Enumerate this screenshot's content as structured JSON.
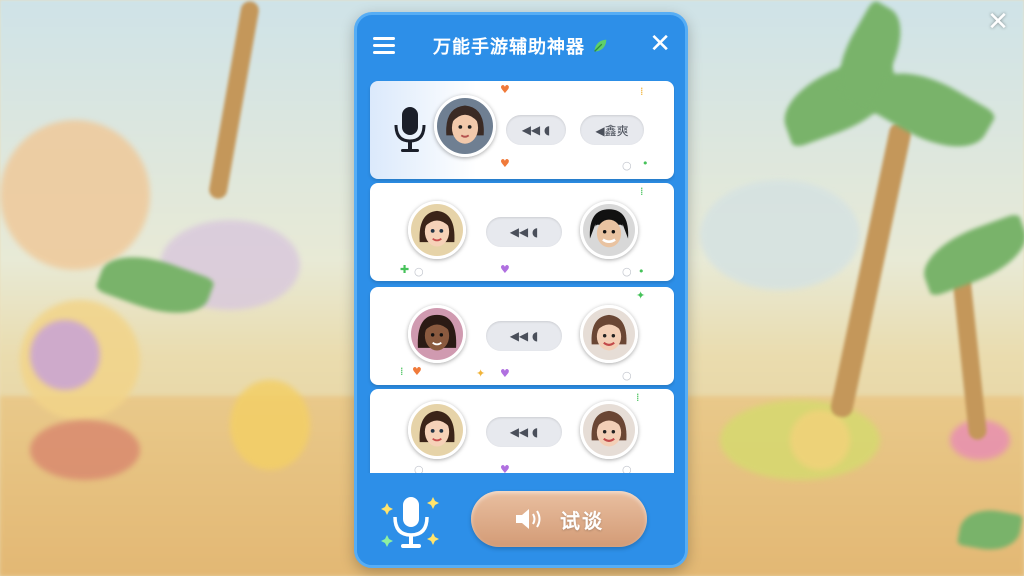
{
  "app": {
    "title": "万能手游辅助神器",
    "close_glyph": "✕"
  },
  "colors": {
    "panel": "#2d8fe8",
    "panel_border": "#56adf5",
    "try_button": "#d39b76",
    "accent_green": "#46c25a"
  },
  "icons": {
    "menu": "menu-icon",
    "title_leaf": "leaf-icon",
    "close": "close-icon",
    "mic": "microphone-icon",
    "speaker": "speaker-icon"
  },
  "voices": {
    "row1": {
      "pill_left": "◀◀ ◖",
      "pill_right": "◀鑫爽"
    },
    "row2": {
      "pill": "◀◀ ◖"
    },
    "row3": {
      "pill": "◀◀ ◖"
    },
    "row4": {
      "pill": "◀◀ ◖"
    }
  },
  "bottom": {
    "try_label": "试谈"
  }
}
